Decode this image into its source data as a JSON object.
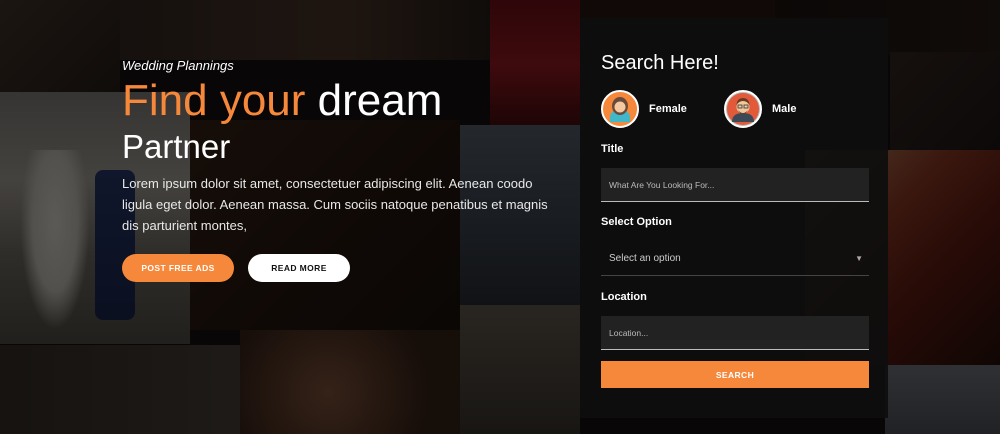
{
  "hero": {
    "subtitle": "Wedding Plannings",
    "headline_accent": "Find your",
    "headline_white": "dream",
    "headline_line2": "Partner",
    "description": "Lorem ipsum dolor sit amet, consectetuer adipiscing elit. Aenean coodo ligula eget dolor. Aenean massa. Cum sociis natoque penatibus et magnis dis parturient montes,",
    "primary_button": "POST FREE ADS",
    "secondary_button": "READ MORE"
  },
  "search_panel": {
    "title": "Search Here!",
    "gender_female": "Female",
    "gender_male": "Male",
    "title_label": "Title",
    "title_placeholder": "What Are You Looking For...",
    "option_label": "Select Option",
    "option_value": "Select an option",
    "location_label": "Location",
    "location_placeholder": "Location...",
    "search_button": "SEARCH"
  },
  "colors": {
    "accent": "#f5883a",
    "panel_bg": "#0e0e0e"
  }
}
